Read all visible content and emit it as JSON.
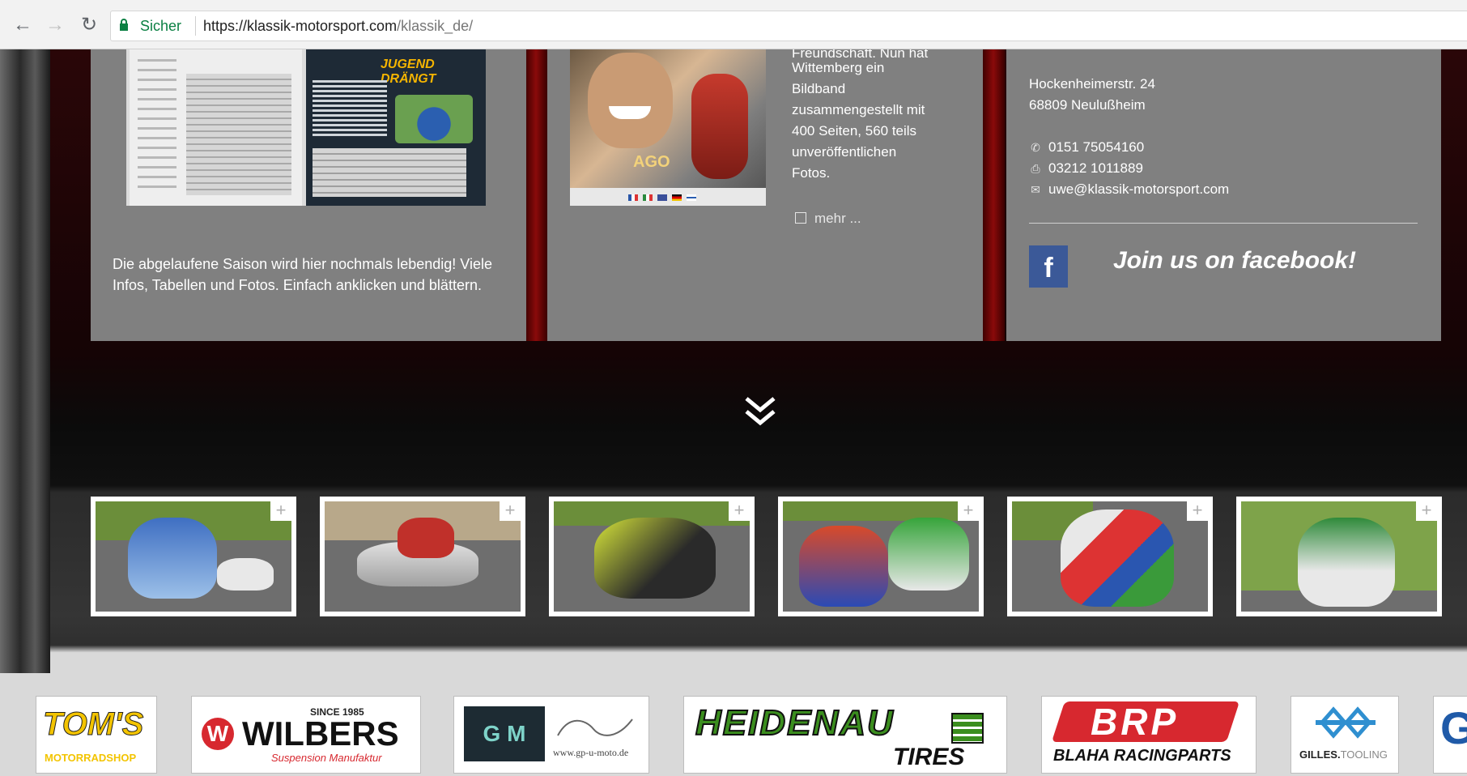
{
  "browser": {
    "secure_label": "Sicher",
    "url_host": "https://klassik-motorsport.com",
    "url_path": "/klassik_de/"
  },
  "box1": {
    "magazine_heading": "JUGEND DRÄNGT",
    "description": "Die abgelaufene Saison wird hier nochmals lebendig! Viele Infos, Tabellen und Fotos. Einfach anklicken und blättern."
  },
  "box2": {
    "cut_line": "Freundschaft. Nun hat",
    "lines": [
      "Wittemberg ein",
      "Bildband",
      "zusammengestellt mit",
      "400 Seiten, 560 teils",
      "unveröffentlichen",
      "Fotos."
    ],
    "photo_text": "AGO",
    "more_label": "mehr ..."
  },
  "contact": {
    "street": "Hockenheimerstr. 24",
    "city": "68809 Neulußheim",
    "phone": "0151 75054160",
    "fax": "03212 1011889",
    "email": "uwe@klassik-motorsport.com",
    "facebook_text": "Join us on facebook!",
    "facebook_icon_letter": "f"
  },
  "gallery": {
    "plus_symbol": "+"
  },
  "partners": {
    "toms_name": "TOM'S",
    "toms_sub": "MOTORRADSHOP",
    "wilbers_since": "SINCE 1985",
    "wilbers_name": "WILBERS",
    "wilbers_sub": "Suspension Manufaktur",
    "gpu_name": "G M",
    "gpu_url": "www.gp-u-moto.de",
    "heidenau_name": "HEIDENAU",
    "heidenau_sub": "TIRES",
    "brp_name": "BRP",
    "brp_sub": "BLAHA RACINGPARTS",
    "gilles_name_bold": "GILLES.",
    "gilles_name_light": "TOOLING",
    "partial_letter": "G"
  },
  "colors": {
    "box_bg": "#808080",
    "facebook_blue": "#3b5998",
    "secure_green": "#0b8043",
    "heidenau_green": "#3b8e1e",
    "brp_red": "#d7282f"
  },
  "icons": {
    "back": "arrow-left-icon",
    "forward": "arrow-right-icon",
    "reload": "reload-icon",
    "lock": "lock-icon",
    "phone": "phone-icon",
    "fax": "fax-icon",
    "mail": "mail-icon",
    "facebook": "facebook-icon",
    "scroll": "double-chevron-down-icon"
  }
}
